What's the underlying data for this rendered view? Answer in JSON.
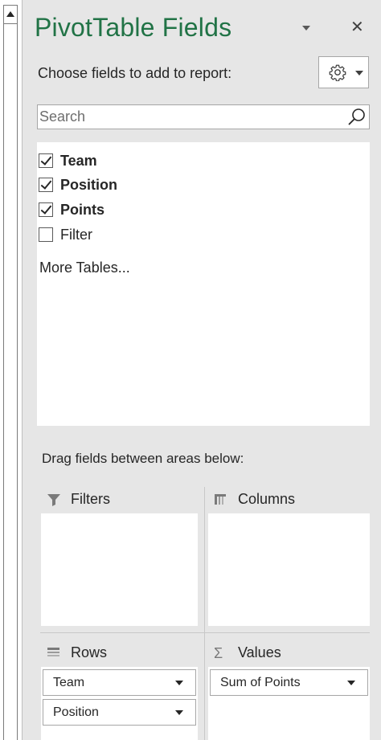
{
  "pane": {
    "title": "PivotTable Fields",
    "close_glyph": "✕",
    "choose_label": "Choose fields to add to report:",
    "accent_color": "#217346"
  },
  "search": {
    "placeholder": "Search",
    "value": ""
  },
  "fields": [
    {
      "label": "Team",
      "checked": true
    },
    {
      "label": "Position",
      "checked": true
    },
    {
      "label": "Points",
      "checked": true
    },
    {
      "label": "Filter",
      "checked": false
    }
  ],
  "more_tables_label": "More Tables...",
  "areas": {
    "instructions": "Drag fields between areas below:",
    "filters": {
      "label": "Filters",
      "icon": "filter-icon",
      "items": []
    },
    "columns": {
      "label": "Columns",
      "icon": "columns-icon",
      "items": []
    },
    "rows": {
      "label": "Rows",
      "icon": "rows-icon",
      "items": [
        "Team",
        "Position"
      ]
    },
    "values": {
      "label": "Values",
      "icon": "sigma-icon",
      "glyph": "Σ",
      "items": [
        "Sum of Points"
      ]
    }
  }
}
